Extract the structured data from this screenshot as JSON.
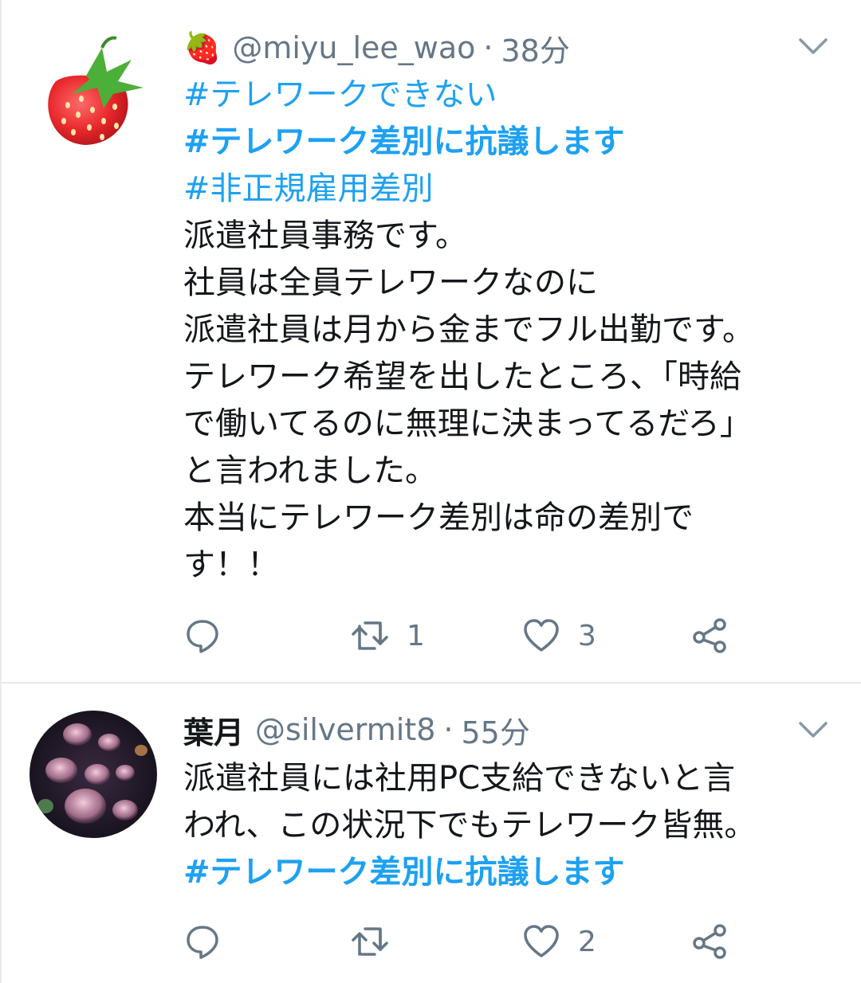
{
  "tweets": [
    {
      "avatar": "strawberry-emoji",
      "name_emoji": "🍓",
      "handle": "@miyu_lee_wao",
      "separator": "·",
      "time": "38分",
      "hashtags": [
        "#テレワークできない",
        "#テレワーク差別に抗議します",
        "#非正規雇用差別"
      ],
      "text_lines": [
        "派遣社員事務です。",
        "社員は全員テレワークなのに",
        "派遣社員は月から金までフル出勤です。",
        "テレワーク希望を出したところ、「時給",
        "で働いてるのに無理に決まってるだろ」",
        "と言われました。",
        "本当にテレワーク差別は命の差別で",
        "す！！"
      ],
      "actions": {
        "reply": "",
        "retweet": "1",
        "like": "3",
        "share": ""
      }
    },
    {
      "avatar": "jellyfish-photo",
      "name": "葉月",
      "handle": "@silvermit8",
      "separator": "·",
      "time": "55分",
      "text_lines": [
        "派遣社員には社用PC支給できないと言",
        "われ、この状況下でもテレワーク皆無。"
      ],
      "hashtags": [
        "#テレワーク差別に抗議します"
      ],
      "actions": {
        "reply": "",
        "retweet": "",
        "like": "2",
        "share": ""
      }
    }
  ],
  "colors": {
    "link": "#1da1f2",
    "secondary": "#657786",
    "divider": "#e1e8ed"
  }
}
